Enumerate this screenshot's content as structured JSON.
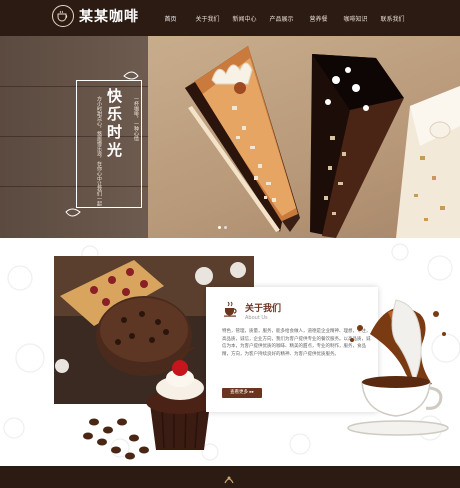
{
  "header": {
    "brand": "某某咖啡",
    "logo_icon": "coffee-cup-icon"
  },
  "nav": {
    "items": [
      {
        "label": "首页",
        "active": true
      },
      {
        "label": "关于我们"
      },
      {
        "label": "新闻中心"
      },
      {
        "label": "产品展示"
      },
      {
        "label": "营养餐"
      },
      {
        "label": "咖啡知识"
      },
      {
        "label": "联系我们"
      }
    ]
  },
  "banner": {
    "title": "快乐时光",
    "text_left": "方小时甜点心，悠居慢乐浪，在你心中让我们一起",
    "text_right": "一杯咖啡，一种心情"
  },
  "about": {
    "title": "关于我们",
    "subtitle": "About Us",
    "body": "特色，管理，质量，服务，能多给会做人，道德是企业精神、理想，专注，高品质，诚信，企业方向，我们为客户提供专业的餐饮服务。以高品质，诚信为本，为客户提供优质的咖啡、精美的甜点，专业的制作，服务，食品精，方向，为客户持续良好的精神、为客户提供优质服务。",
    "button": "查看更多 ▸▸"
  },
  "colors": {
    "header_bg": "#2c1b13",
    "accent": "#6b3320"
  }
}
